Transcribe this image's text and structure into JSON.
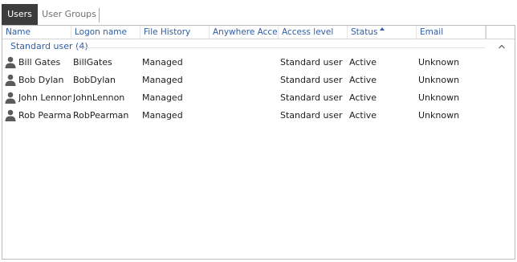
{
  "tabs": [
    {
      "label": "Users",
      "active": true
    },
    {
      "label": "User Groups",
      "active": false
    }
  ],
  "columns": [
    "Name",
    "Logon name",
    "File History",
    "Anywhere Access",
    "Access level",
    "Status",
    "Email"
  ],
  "sort": {
    "column": "Status",
    "direction": "ascending"
  },
  "group": {
    "label": "Standard user (4)"
  },
  "rows": [
    {
      "name": "Bill Gates",
      "logon": "BillGates",
      "file_history": "Managed",
      "anywhere_access": "",
      "access_level": "Standard user",
      "status": "Active",
      "email": "Unknown"
    },
    {
      "name": "Bob Dylan",
      "logon": "BobDylan",
      "file_history": "Managed",
      "anywhere_access": "",
      "access_level": "Standard user",
      "status": "Active",
      "email": "Unknown"
    },
    {
      "name": "John Lennon",
      "logon": "JohnLennon",
      "file_history": "Managed",
      "anywhere_access": "",
      "access_level": "Standard user",
      "status": "Active",
      "email": "Unknown"
    },
    {
      "name": "Rob Pearman",
      "logon": "RobPearman",
      "file_history": "Managed",
      "anywhere_access": "",
      "access_level": "Standard user",
      "status": "Active",
      "email": "Unknown"
    }
  ],
  "colors": {
    "active_tab_bg": "#3c3c3c",
    "header_text": "#2f5ea5",
    "body_text": "#1e1e1e",
    "icon": "#5b5b5b"
  },
  "icons": {
    "user": "user-icon",
    "sort": "sort-ascending-icon",
    "collapse": "chevron-up-icon"
  }
}
